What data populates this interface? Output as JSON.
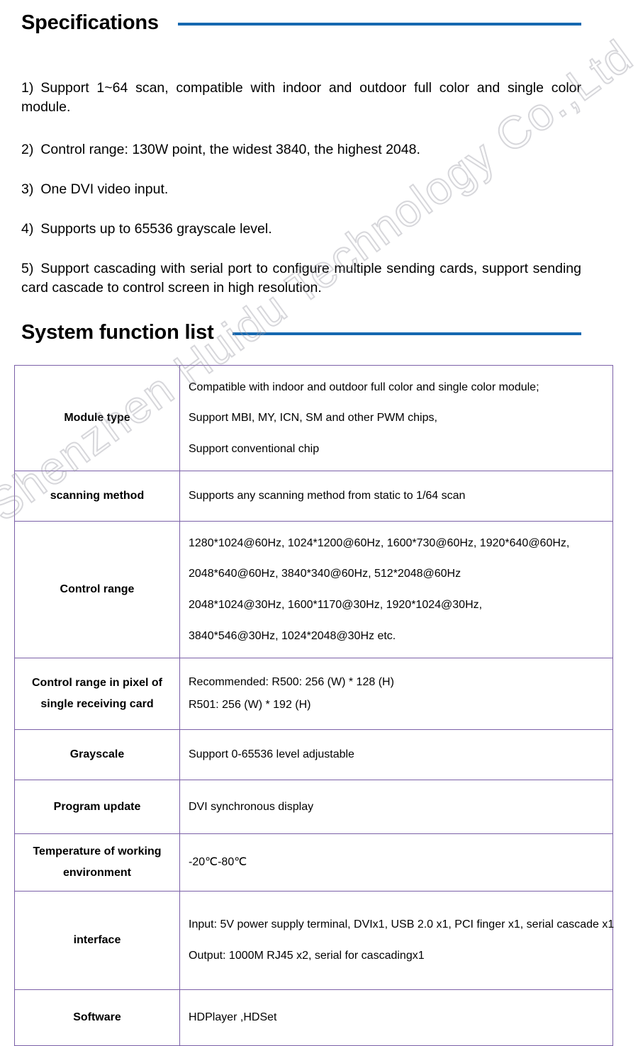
{
  "document": {
    "watermark": "Shenzhen Huidu Technology Co.,Ltd",
    "accent_color": "#1568b0",
    "table_border_color": "#7b60a8"
  },
  "sections": {
    "specifications": {
      "title": "Specifications",
      "items": [
        {
          "marker": "1)",
          "text": "Support 1~64 scan, compatible with indoor and outdoor full color and single color module."
        },
        {
          "marker": "2)",
          "text": "Control range: 130W point, the widest 3840, the highest 2048."
        },
        {
          "marker": "3)",
          "text": "One DVI video input."
        },
        {
          "marker": "4)",
          "text": "Supports up to 65536 grayscale level."
        },
        {
          "marker": "5)",
          "text": "Support cascading with serial port to configure multiple sending cards, support sending card cascade to control screen in high resolution."
        }
      ]
    },
    "system_function_list": {
      "title": "System function list",
      "rows": [
        {
          "label": "Module type",
          "lines": [
            "Compatible with indoor and outdoor full color and single color module;",
            "Support MBI, MY, ICN, SM and other PWM chips,",
            "Support conventional chip"
          ]
        },
        {
          "label": "scanning method",
          "lines": [
            "Supports any scanning method from static to 1/64 scan"
          ]
        },
        {
          "label": "Control range",
          "lines": [
            "1280*1024@60Hz, 1024*1200@60Hz, 1600*730@60Hz, 1920*640@60Hz,",
            "2048*640@60Hz, 3840*340@60Hz, 512*2048@60Hz",
            "2048*1024@30Hz, 1600*1170@30Hz, 1920*1024@30Hz,",
            "3840*546@30Hz, 1024*2048@30Hz etc."
          ]
        },
        {
          "label": "Control range in pixel of single receiving card",
          "label_line1": "Control range in pixel of",
          "label_line2": "single receiving card",
          "lines": [
            "Recommended: R500: 256 (W) * 128 (H)",
            "R501: 256 (W) * 192 (H)"
          ]
        },
        {
          "label": "Grayscale",
          "lines": [
            "Support 0-65536 level adjustable"
          ]
        },
        {
          "label": "Program update",
          "lines": [
            "DVI synchronous display"
          ]
        },
        {
          "label": "Temperature of working environment",
          "label_line1": "Temperature of working",
          "label_line2": "environment",
          "lines": [
            "-20℃-80℃"
          ]
        },
        {
          "label": "interface",
          "lines": [
            "Input: 5V power supply terminal, DVIx1, USB 2.0 x1, PCI finger x1, serial cascade x1",
            "Output: 1000M RJ45 x2, serial for cascadingx1"
          ]
        },
        {
          "label": "Software",
          "lines": [
            "HDPlayer ,HDSet"
          ]
        }
      ]
    }
  }
}
